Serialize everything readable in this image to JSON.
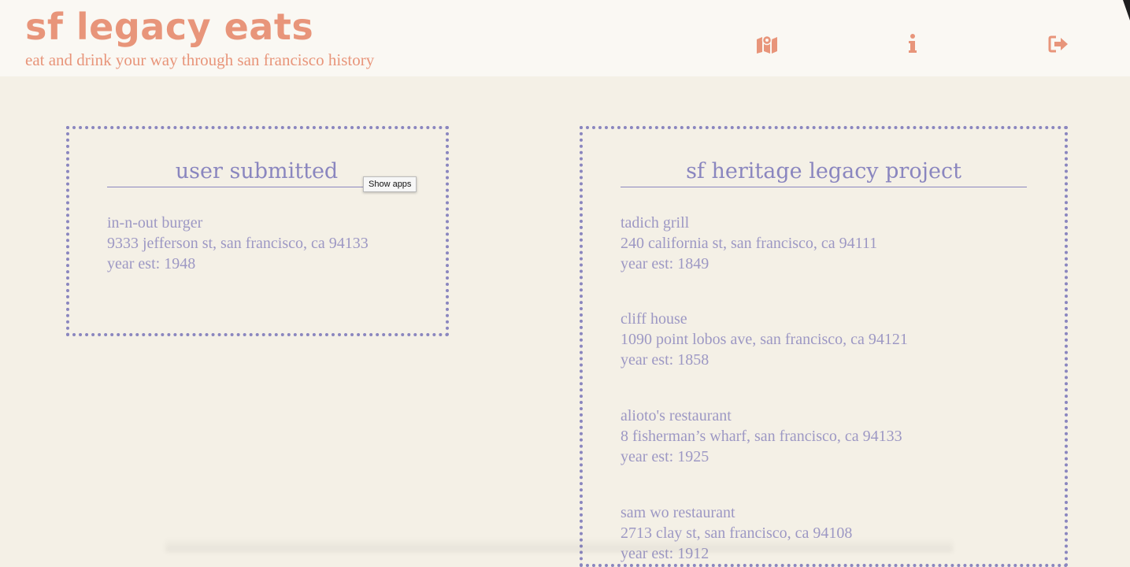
{
  "header": {
    "title": "sf legacy eats",
    "tagline": "eat and drink your way through san francisco history",
    "nav": [
      {
        "icon": "map-icon"
      },
      {
        "icon": "info-icon"
      },
      {
        "icon": "sign-out-icon"
      }
    ]
  },
  "tooltip": "Show apps",
  "user_panel": {
    "title": "user submitted",
    "entries": [
      {
        "name": "in-n-out burger",
        "address": "9333 jefferson st, san francisco, ca 94133",
        "year": "year est: 1948"
      }
    ]
  },
  "legacy_panel": {
    "title": "sf heritage legacy project",
    "entries": [
      {
        "name": "tadich grill",
        "address": "240 california st, san francisco, ca 94111",
        "year": "year est: 1849"
      },
      {
        "name": "cliff house",
        "address": "1090 point lobos ave, san francisco, ca 94121",
        "year": "year est: 1858"
      },
      {
        "name": "alioto's restaurant",
        "address": "8 fisherman’s wharf, san francisco, ca 94133",
        "year": "year est: 1925"
      },
      {
        "name": "sam wo restaurant",
        "address": "2713 clay st, san francisco, ca 94108",
        "year": "year est: 1912"
      }
    ]
  },
  "colors": {
    "accent": "#e8957a",
    "panel": "#8a86bf",
    "text": "#9d98c4",
    "background": "#f4f0e6",
    "header_bg": "#faf8f3"
  }
}
